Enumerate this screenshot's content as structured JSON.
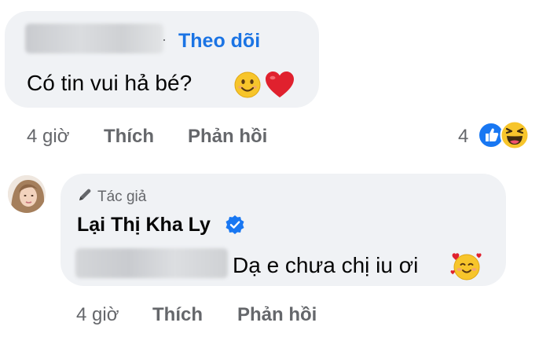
{
  "comment": {
    "follow_label": "Theo dõi",
    "separator": "·",
    "text": "Có tin vui hả bé?",
    "emojis": [
      "smiling-face-icon",
      "red-heart-icon"
    ],
    "time": "4 giờ",
    "like_label": "Thích",
    "reply_label": "Phản hồi",
    "reaction_count": "4",
    "reactions": [
      "like-icon",
      "haha-icon"
    ]
  },
  "reply": {
    "author_badge": "Tác giả",
    "author_name": "Lại Thị Kha Ly",
    "verified_icon": "verified-badge-icon",
    "text": "Dạ e chưa chị iu ơi",
    "emoji": "smiling-face-with-hearts-icon",
    "time": "4 giờ",
    "like_label": "Thích",
    "reply_label": "Phản hồi"
  },
  "colors": {
    "bubble": "#f0f2f5",
    "link": "#1b74e4",
    "meta": "#65676b",
    "verified": "#1877f2"
  }
}
